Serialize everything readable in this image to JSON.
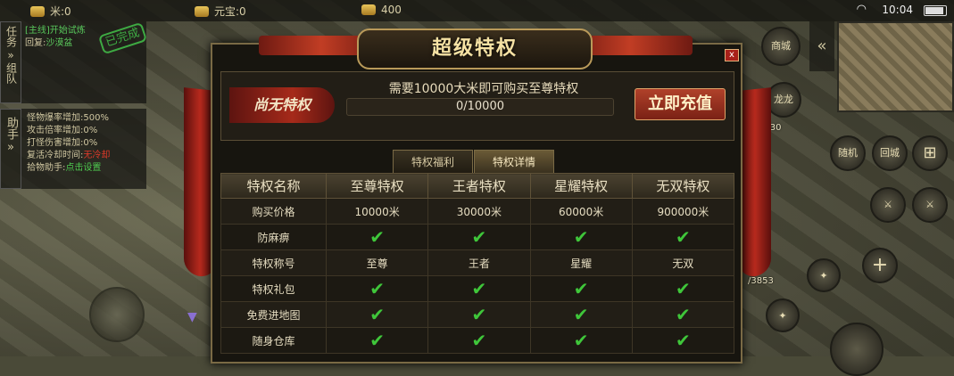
{
  "top_bar": {
    "rice": "米:0",
    "yuanbao": "元宝:0",
    "gold": "400",
    "clock": "10:04"
  },
  "side": {
    "task_tab": "任务",
    "team_tab": "组队",
    "help_tab": "助手",
    "quest_line1": "[主线]开始试炼",
    "quest_line2_label": "回复:",
    "quest_line2_value": "沙漠盆",
    "quest_done": "已完成",
    "help_lines": [
      {
        "label": "怪物爆率增加:",
        "value": "500%"
      },
      {
        "label": "攻击倍率增加:",
        "value": "0%"
      },
      {
        "label": "打怪伤害增加:",
        "value": "0%"
      },
      {
        "label": "复活冷却时间:",
        "value": "无冷却"
      },
      {
        "label": "拾物助手:",
        "value": "点击设置"
      }
    ]
  },
  "hud": {
    "shop": "商城",
    "avatar": "龙龙",
    "score_a": "1830",
    "score_b": "/3853",
    "return": "随机",
    "home": "回城"
  },
  "dialog": {
    "title": "超级特权",
    "close": "x",
    "status_badge": "尚无特权",
    "message": "需要10000大米即可购买至尊特权",
    "progress": {
      "current": 0,
      "total": 10000,
      "label": "0/10000"
    },
    "recharge_button": "立即充值",
    "tabs": [
      "特权福利",
      "特权详情"
    ],
    "active_tab": "特权详情",
    "table": {
      "headers": [
        "特权名称",
        "至尊特权",
        "王者特权",
        "星耀特权",
        "无双特权"
      ],
      "rows": [
        {
          "label": "购买价格",
          "cells": [
            "10000米",
            "30000米",
            "60000米",
            "900000米"
          ]
        },
        {
          "label": "防麻痹",
          "cells": [
            "✔",
            "✔",
            "✔",
            "✔"
          ]
        },
        {
          "label": "特权称号",
          "cells": [
            "至尊",
            "王者",
            "星耀",
            "无双"
          ]
        },
        {
          "label": "特权礼包",
          "cells": [
            "✔",
            "✔",
            "✔",
            "✔"
          ]
        },
        {
          "label": "免费进地图",
          "cells": [
            "✔",
            "✔",
            "✔",
            "✔"
          ]
        },
        {
          "label": "随身仓库",
          "cells": [
            "✔",
            "✔",
            "✔",
            "✔"
          ]
        }
      ]
    }
  }
}
